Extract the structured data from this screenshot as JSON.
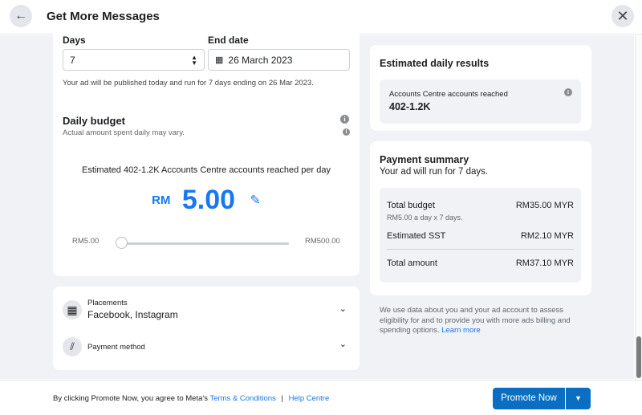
{
  "header": {
    "title": "Get More Messages"
  },
  "duration": {
    "days_label": "Days",
    "days_value": "7",
    "end_label": "End date",
    "end_value": "26 March 2023",
    "note": "Your ad will be published today and run for 7 days ending on 26 Mar 2023."
  },
  "budget": {
    "title": "Daily budget",
    "subtitle": "Actual amount spent daily may vary.",
    "estimate": "Estimated 402-1.2K Accounts Centre accounts reached per day",
    "currency": "RM",
    "amount": "5.00",
    "min": "RM5.00",
    "max": "RM500.00",
    "slider_value_fraction": 0
  },
  "options": [
    {
      "label": "Placements",
      "value": "Facebook, Instagram",
      "icon": "grid-icon"
    },
    {
      "label": "Payment method",
      "value": "",
      "icon": "card-icon"
    }
  ],
  "results": {
    "title": "Estimated daily results",
    "metric_label": "Accounts Centre accounts reached",
    "metric_value": "402-1.2K"
  },
  "payment": {
    "title": "Payment summary",
    "subtitle": "Your ad will run for 7 days.",
    "rows": [
      {
        "label": "Total budget",
        "sub": "RM5.00 a day x 7 days.",
        "value": "RM35.00 MYR"
      },
      {
        "label": "Estimated SST",
        "value": "RM2.10 MYR"
      },
      {
        "label": "Total amount",
        "value": "RM37.10 MYR"
      }
    ]
  },
  "disclaimer": {
    "text": "We use data about you and your ad account to assess eligibility for and to provide you with more ads billing and spending options.",
    "link": "Learn more"
  },
  "footer": {
    "text": "By clicking Promote Now, you agree to Meta's",
    "terms": "Terms & Conditions",
    "sep": "|",
    "help": "Help Centre",
    "promote": "Promote Now"
  },
  "colors": {
    "accent": "#1877f2",
    "button": "#0a6fc2"
  }
}
